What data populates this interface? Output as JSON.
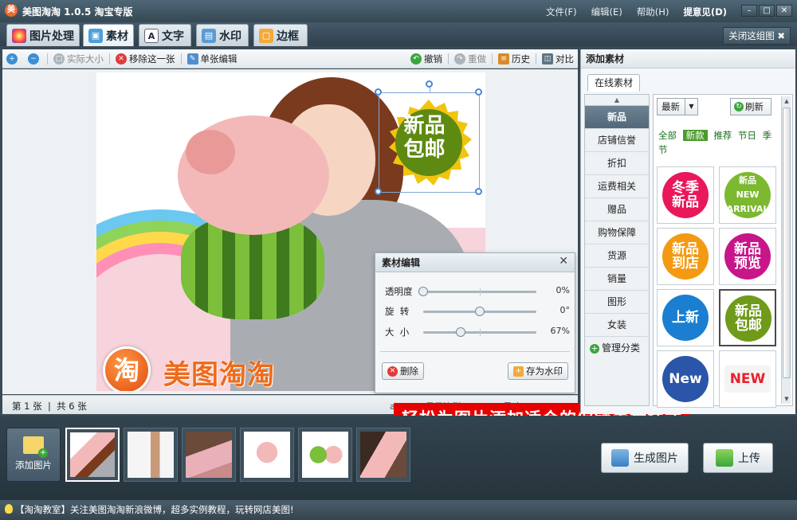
{
  "window": {
    "title": "美图淘淘 1.0.5 淘宝专版",
    "menu": [
      "文件(F)",
      "编辑(E)",
      "帮助(H)",
      "提意见(D)"
    ]
  },
  "tabs": [
    "图片处理",
    "素材",
    "文字",
    "水印",
    "边框"
  ],
  "close_group": "关闭这组图",
  "toolbar": {
    "actual_size": "实际大小",
    "remove": "移除这一张",
    "single_edit": "单张编辑",
    "undo": "撤销",
    "redo": "重做",
    "history": "历史",
    "compare": "对比"
  },
  "canvas": {
    "sticker_text": [
      "新品",
      "包邮"
    ],
    "logo_char": "淘",
    "logo_word": "美图淘淘"
  },
  "editor": {
    "title": "素材编辑",
    "sliders": [
      {
        "label": "透明度",
        "value": "0%",
        "level": 0
      },
      {
        "label": "旋  转",
        "value": "0°",
        "level": 0.5
      },
      {
        "label": "大  小",
        "value": "67%",
        "level": 0.33
      }
    ],
    "delete_label": "删除",
    "save_watermark_label": "存为水印"
  },
  "status": {
    "left": "第 1 张  |  共 6 张",
    "right": "a1.jpg  |  显示比例：100%  |  尺寸：500×411"
  },
  "promo": "轻松为图片添加适合的促销素材样式",
  "right_panel": {
    "title": "添加素材",
    "online_tab": "在线素材",
    "categories": [
      "新品",
      "店铺信誉",
      "折扣",
      "运费相关",
      "赠品",
      "购物保障",
      "货源",
      "销量",
      "图形",
      "女装"
    ],
    "manage": "管理分类",
    "sort_value": "最新",
    "refresh": "刷新",
    "filters": [
      "全部",
      "新款",
      "推荐",
      "节日",
      "季节"
    ],
    "materials": [
      {
        "text": "冬季\n新品",
        "color": "#e8185a"
      },
      {
        "text": "新品\nNEW ARRIVAL",
        "color": "#7cb830"
      },
      {
        "text": "新品\n到店",
        "color": "#f39a12"
      },
      {
        "text": "新品\n预览",
        "color": "#c8168a"
      },
      {
        "text": "上新",
        "color": "#1a7fd0"
      },
      {
        "text": "新品\n包邮",
        "color": "#6f9a1a"
      },
      {
        "text": "New",
        "color": "#2b55a8"
      },
      {
        "text": "NEW",
        "color": "#e8202a"
      }
    ]
  },
  "bottom": {
    "add_image": "添加图片",
    "generate": "生成图片",
    "upload": "上传"
  },
  "footer": "【淘淘教室】关注美图淘淘新浪微博，超多实例教程，玩转网店美图!"
}
